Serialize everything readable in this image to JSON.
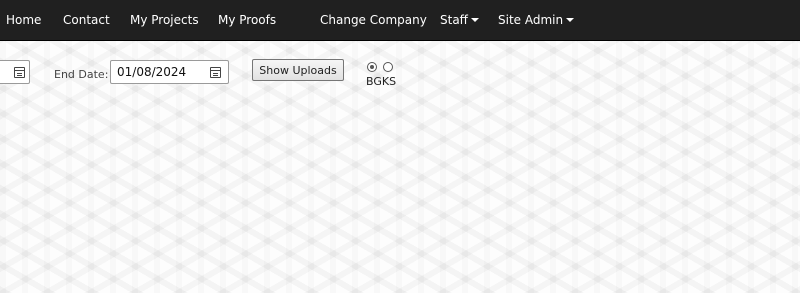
{
  "nav": {
    "items": [
      "Home",
      "Contact",
      "My Projects",
      "My Proofs",
      "Change Company",
      "Staff",
      "Site Admin"
    ]
  },
  "form": {
    "end_date_label": "End Date:",
    "end_date_value": "01/08/2024",
    "show_uploads_label": "Show Uploads",
    "radio_label": "BGKS",
    "radio_selected": "first"
  }
}
